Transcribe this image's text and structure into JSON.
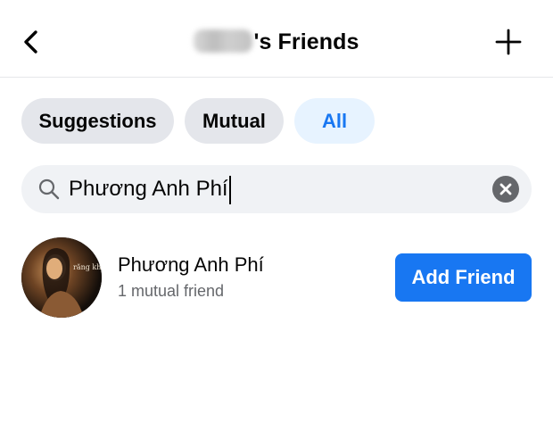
{
  "header": {
    "title_suffix": "'s Friends",
    "back_icon": "chevron-left-icon",
    "add_icon": "plus-icon"
  },
  "filters": {
    "chips": [
      {
        "label": "Suggestions",
        "selected": false
      },
      {
        "label": "Mutual",
        "selected": false
      },
      {
        "label": "All",
        "selected": true
      }
    ]
  },
  "search": {
    "value": "Phương Anh Phí",
    "icon": "search-icon",
    "clear_icon": "clear-icon"
  },
  "results": [
    {
      "name": "Phương Anh Phí",
      "mutual": "1 mutual friend",
      "action_label": "Add Friend",
      "avatar_text": "răng khôn"
    }
  ],
  "colors": {
    "accent": "#1877f2",
    "accent_light": "#e7f3ff",
    "chip_bg": "#e4e6eb",
    "search_bg": "#f0f2f5",
    "secondary_text": "#65676b"
  }
}
